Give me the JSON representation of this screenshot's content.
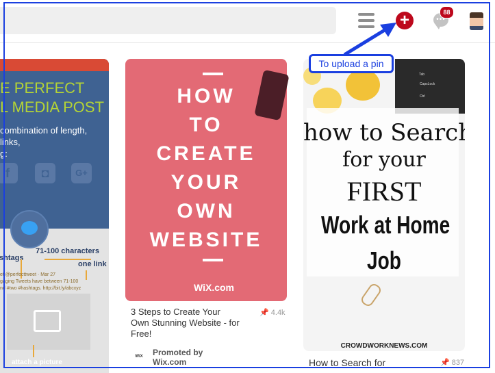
{
  "header": {
    "notifications_count": "88",
    "menu_icon": "hamburger-icon",
    "add_icon": "plus-circle-icon",
    "messages_icon": "chat-bubble-icon",
    "accent": "#bd081c"
  },
  "annotation": {
    "label": "To upload a pin",
    "color": "#1a3fe0"
  },
  "pins": [
    {
      "heading": [
        "E PERFECT",
        "L MEDIA POST"
      ],
      "text": [
        "combination of length, links,",
        "g:"
      ],
      "social_icons": [
        "f",
        "◘",
        "G+"
      ],
      "labels": {
        "chars": "71-100 characters",
        "hashtags": "shtags",
        "link": "one link",
        "picture": "attach a picture"
      },
      "tweet_lines": [
        "et @perfecttweet · Mar 27",
        "gaging Tweets have between 71-100",
        "nd #two #hashtags. http://bit.ly/abcxyz"
      ]
    },
    {
      "image_lines": [
        "HOW",
        "TO",
        "CREATE",
        "YOUR",
        "OWN",
        "WEBSITE"
      ],
      "brand": "WiX.com",
      "title": "3 Steps to Create Your Own Stunning Website - for Free!",
      "saves": "4.4k",
      "promoted_label": "Promoted by",
      "promoted_by": "Wix.com",
      "logo_text": "WiX"
    },
    {
      "image_lines": [
        "how to Search",
        "for your",
        "FIRST",
        "Work at Home",
        "Job"
      ],
      "watermark": "CROWDWORKNEWS.COM",
      "title": "How to Search for",
      "saves": "837",
      "keyboard_keys": [
        "Tab",
        "CapsLock",
        "Ctrl"
      ]
    }
  ]
}
